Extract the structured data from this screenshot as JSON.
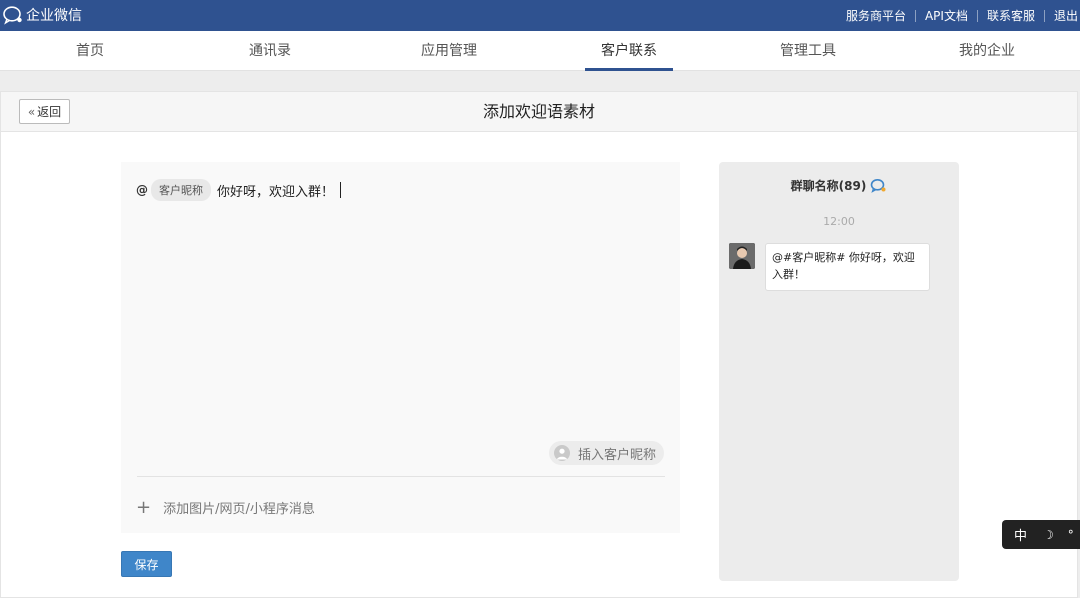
{
  "topbar": {
    "app_name": "企业微信",
    "links": [
      "服务商平台",
      "API文档",
      "联系客服",
      "退出"
    ]
  },
  "nav": {
    "items": [
      "首页",
      "通讯录",
      "应用管理",
      "客户联系",
      "管理工具",
      "我的企业"
    ],
    "active_index": 3
  },
  "panel": {
    "back_label": "返回",
    "title": "添加欢迎语素材"
  },
  "editor": {
    "at_symbol": "@",
    "nickname_chip": "客户昵称",
    "message": "你好呀，欢迎入群！",
    "insert_nickname_label": "插入客户昵称",
    "add_attachment_label": "添加图片/网页/小程序消息",
    "save_label": "保存"
  },
  "preview": {
    "group_name": "群聊名称(89)",
    "time": "12:00",
    "bubble_text": "@#客户昵称# 你好呀，欢迎入群！"
  },
  "ime": {
    "mode": "中",
    "moon": "☽",
    "degree": "°"
  },
  "colors": {
    "topbar": "#2f5290",
    "primary_button": "#3f86c9"
  }
}
